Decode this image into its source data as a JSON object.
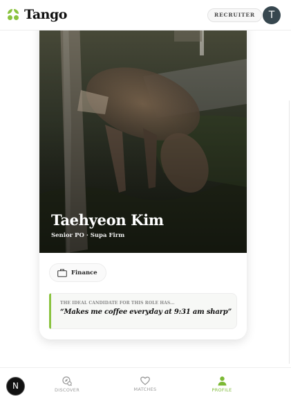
{
  "app": {
    "name": "Tango",
    "role_label": "RECRUITER",
    "avatar_initial": "T",
    "accent_color": "#8ac33f"
  },
  "profile": {
    "name": "Taehyeon Kim",
    "subtitle": "Senior PO · Supa Firm",
    "photo_description_icon": "photo",
    "tag": {
      "icon": "briefcase-icon",
      "label": "Finance"
    },
    "ideal_candidate": {
      "label": "THE IDEAL CANDIDATE FOR THIS ROLE HAS...",
      "quote": "“Makes me coffee everyday at 9:31 am sharp”"
    }
  },
  "bottom_nav": {
    "items": [
      {
        "id": "discover",
        "label": "DISCOVER",
        "icon": "discover-icon",
        "active": false
      },
      {
        "id": "matches",
        "label": "MATCHES",
        "icon": "heart-icon",
        "active": false
      },
      {
        "id": "profile",
        "label": "PROFILE",
        "icon": "person-icon",
        "active": true
      }
    ]
  },
  "dev_badge": {
    "label": "N"
  }
}
